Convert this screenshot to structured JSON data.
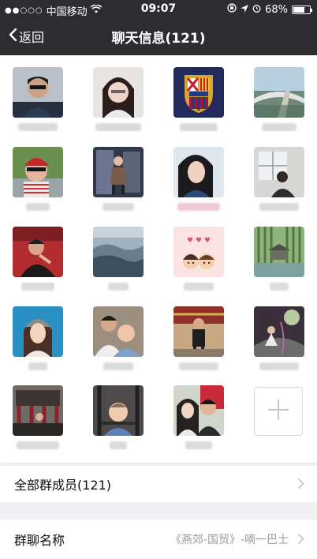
{
  "status_bar": {
    "signal_dots": "●●○○○",
    "carrier": "中国移动",
    "time": "09:07",
    "battery": "68%",
    "battery_level": 0.68
  },
  "nav": {
    "back_label": "返回",
    "title": "聊天信息(121)"
  },
  "rows": {
    "all_members_label": "全部群成员(121)",
    "group_name_label": "群聊名称",
    "group_name_value": "《燕郊-国贸》-嘀一巴士"
  },
  "colors": {
    "header_bg": "#2d2d31",
    "page_bg": "#efeff4"
  },
  "icons": [
    "wifi-icon",
    "lock-rotation-icon",
    "location-icon",
    "alarm-icon",
    "battery-icon",
    "chevron-left-icon",
    "chevron-right-icon",
    "add-member-icon"
  ]
}
